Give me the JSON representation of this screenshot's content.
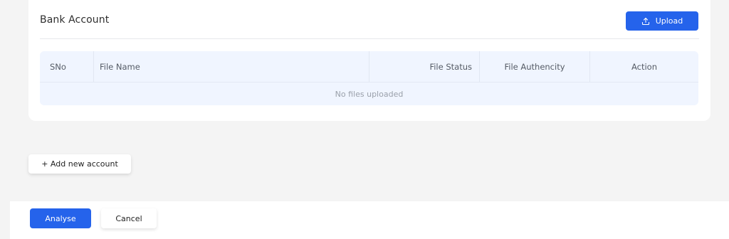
{
  "card": {
    "title": "Bank Account",
    "upload_label": "Upload"
  },
  "table": {
    "columns": [
      "SNo",
      "File Name",
      "File Status",
      "File Authencity",
      "Action"
    ],
    "empty_text": "No files uploaded"
  },
  "actions": {
    "add_account_label": "+ Add new account",
    "analyse_label": "Analyse",
    "cancel_label": "Cancel"
  },
  "colors": {
    "primary": "#2563eb",
    "table_bg": "#f0f5ff",
    "page_bg": "#f4f4f4"
  },
  "icons": {
    "upload": "upload-icon"
  }
}
